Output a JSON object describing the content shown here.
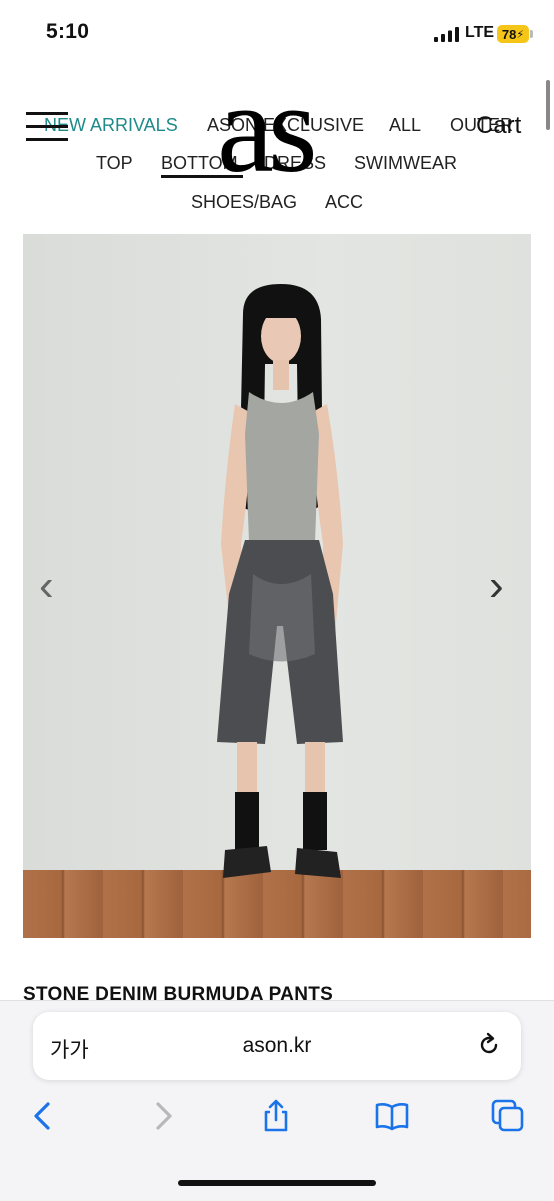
{
  "status": {
    "time": "5:10",
    "network": "LTE",
    "battery": "78"
  },
  "nav": {
    "row1": [
      "NEW ARRIVALS",
      "ASON EXCLUSIVE",
      "ALL",
      "OUTER"
    ],
    "row2": [
      "TOP",
      "BOTTOM",
      "DRESS",
      "SWIMWEAR"
    ],
    "row3": [
      "SHOES/BAG",
      "ACC"
    ],
    "active_color": "#1f8a8a"
  },
  "logo": "as",
  "cart_label": "Cart",
  "product": {
    "title": "STONE DENIM BURMUDA PANTS"
  },
  "browser": {
    "text_size_label": "가가",
    "url": "ason.kr"
  }
}
